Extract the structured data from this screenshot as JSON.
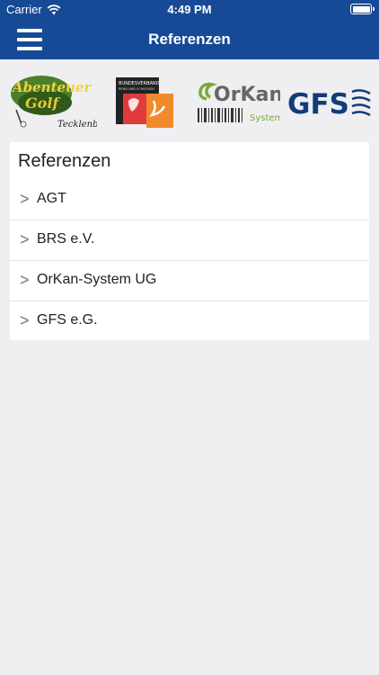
{
  "status": {
    "carrier": "Carrier",
    "time": "4:49 PM"
  },
  "nav": {
    "title": "Referenzen"
  },
  "logos": [
    {
      "name": "AGT",
      "text_top": "Abenteuer",
      "text_mid": "Golf",
      "text_bottom": "Tecklenburg"
    },
    {
      "name": "BRS",
      "text_top": "BUNDESVERBAND",
      "text_mid": "RENN UND SCHIESSEN"
    },
    {
      "name": "OrKan",
      "text_top": "OrKan",
      "text_bottom": "System"
    },
    {
      "name": "GFS",
      "text_top": "GFS"
    }
  ],
  "card": {
    "title": "Referenzen",
    "items": [
      {
        "label": "AGT"
      },
      {
        "label": "BRS e.V."
      },
      {
        "label": "OrKan-System UG"
      },
      {
        "label": "GFS e.G."
      }
    ]
  },
  "icons": {
    "chevron": ">"
  }
}
